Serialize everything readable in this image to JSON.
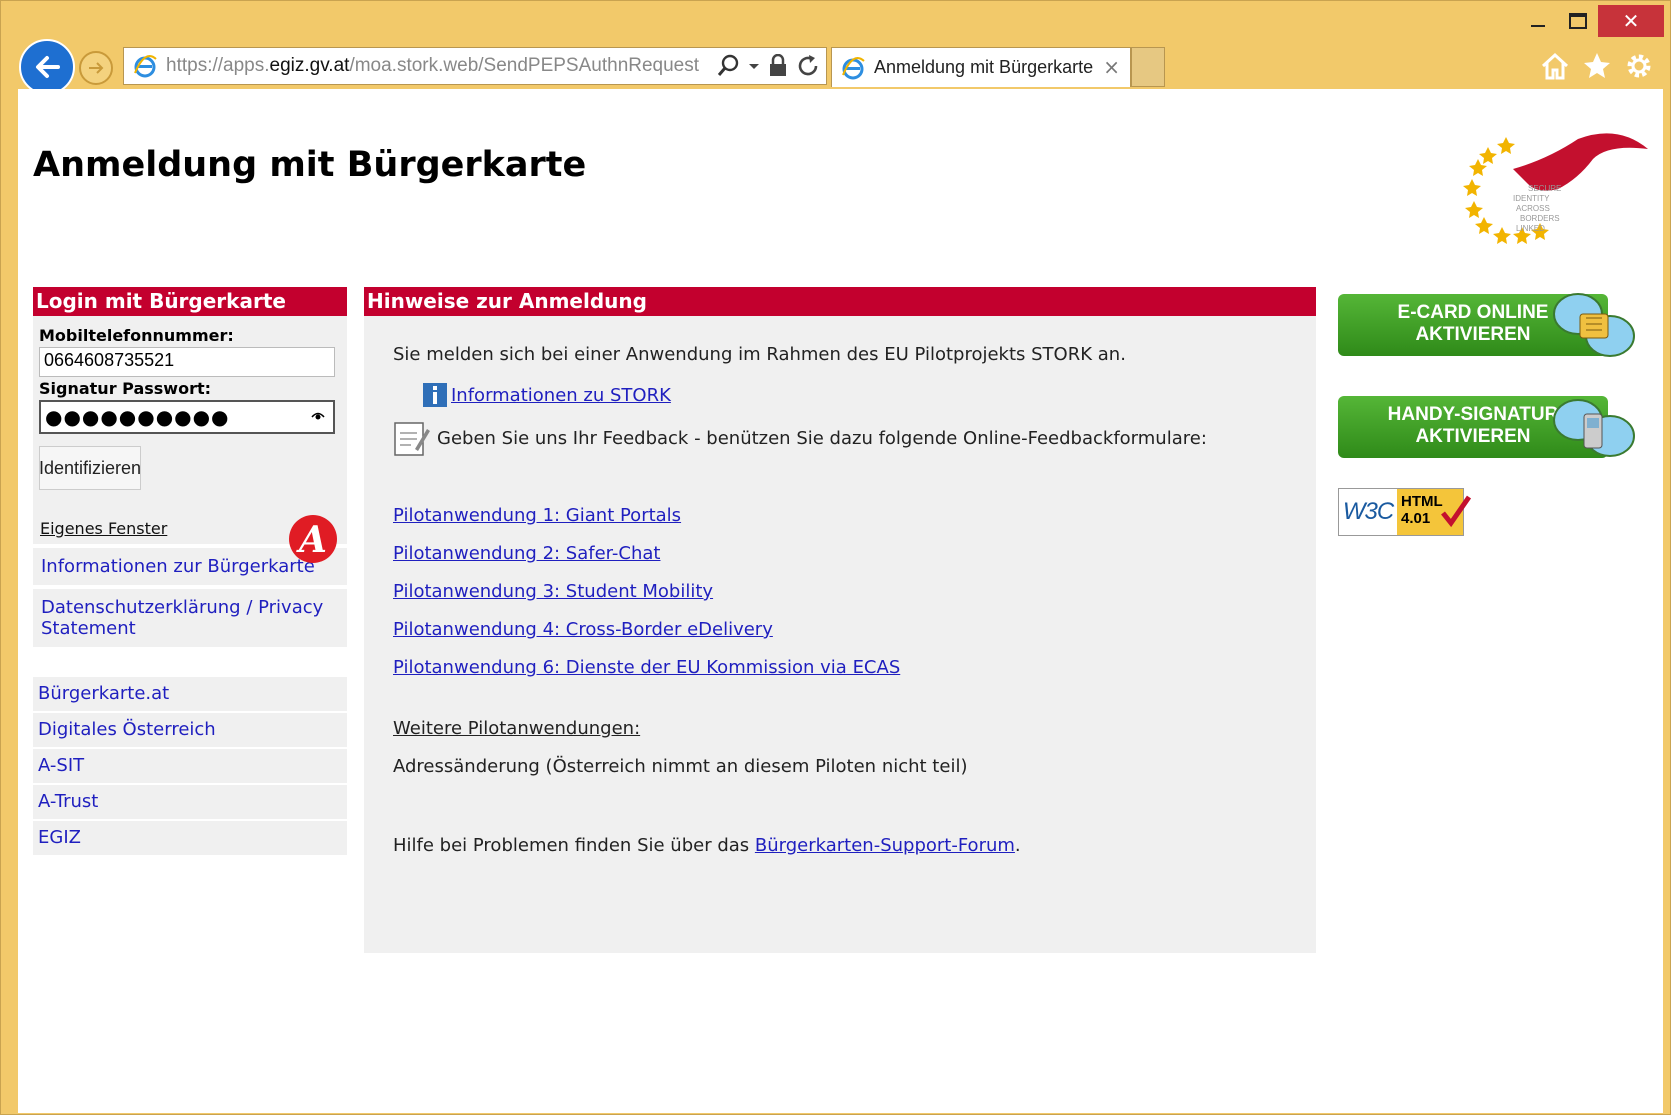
{
  "browser": {
    "url_prefix": "https://apps.",
    "url_domain": "egiz.gv.at",
    "url_path": "/moa.stork.web/SendPEPSAuthnRequest",
    "tab_title": "Anmeldung mit Bürgerkarte",
    "tab_close": "×",
    "caption_close": "✕"
  },
  "page": {
    "title": "Anmeldung mit Bürgerkarte"
  },
  "login": {
    "header": "Login mit Bürgerkarte",
    "phone_label": "Mobiltelefonnummer:",
    "phone_value": "0664608735521",
    "password_label": "Signatur Passwort:",
    "password_mask": "●●●●●●●●●●",
    "submit_label": "Identifizieren",
    "own_window": "Eigenes Fenster",
    "info_link": "Informationen zur Bürgerkarte",
    "privacy_link": "Datenschutzerklärung / Privacy Statement"
  },
  "side_links": [
    "Bürgerkarte.at",
    "Digitales Österreich",
    "A-SIT",
    "A-Trust",
    "EGIZ"
  ],
  "main": {
    "header": "Hinweise zur Anmeldung",
    "intro": "Sie melden sich bei einer Anwendung im Rahmen des EU Pilotprojekts STORK an.",
    "stork_info": "Informationen zu STORK",
    "feedback": "Geben Sie uns Ihr Feedback - benützen Sie dazu folgende Online-Feedbackformulare:",
    "pilots": [
      "Pilotanwendung 1: Giant Portals",
      "Pilotanwendung 2: Safer-Chat",
      "Pilotanwendung 3: Student Mobility",
      "Pilotanwendung 4: Cross-Border eDelivery",
      "Pilotanwendung 6: Dienste der EU Kommission via ECAS"
    ],
    "further": "Weitere Pilotanwendungen:",
    "address_change": "Adressänderung (Österreich nimmt an diesem Piloten nicht teil)",
    "help_prefix": "Hilfe bei Problemen finden Sie über das ",
    "help_link": "Bürgerkarten-Support-Forum",
    "help_suffix": "."
  },
  "banners": {
    "ecard_line1": "E-CARD ONLINE",
    "ecard_line2": "AKTIVIEREN",
    "handy_line1": "HANDY-SIGNATUR",
    "handy_line2": "AKTIVIEREN",
    "w3c_text": "W3C",
    "html_badge_line1": "HTML",
    "html_badge_line2": "4.01"
  },
  "logo": {
    "stork_words": [
      "SECURE",
      "IDENTITY",
      "ACROSS",
      "BORDERS",
      "LINKED"
    ]
  },
  "colors": {
    "accent_red": "#c3002e",
    "link_blue": "#1f1fbf",
    "chrome_frame": "#f2c96a"
  }
}
